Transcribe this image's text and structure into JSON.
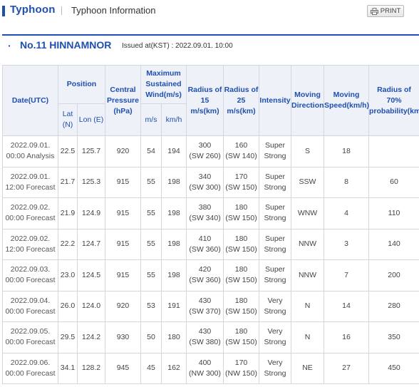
{
  "header": {
    "brand": "Typhoon",
    "subtitle": "Typhoon Information",
    "print_label": "PRINT"
  },
  "storm": {
    "name": "No.11 HINNAMNOR",
    "issued": "Issued at(KST) : 2022.09.01. 10:00"
  },
  "table": {
    "headers": {
      "date": "Date(UTC)",
      "position": "Position",
      "lat": "Lat (N)",
      "lon": "Lon (E)",
      "pressure": "Central Pressure (hPa)",
      "wind": "Maximum Sustained Wind(m/s)",
      "wind_ms": "m/s",
      "wind_kmh": "km/h",
      "r15": "Radius of 15 m/s(km)",
      "r25": "Radius of 25 m/s(km)",
      "intensity": "Intensity",
      "direction": "Moving Direction",
      "speed": "Moving Speed(km/h)",
      "r70": "Radius of 70% probability(km)"
    },
    "rows": [
      {
        "date1": "2022.09.01.",
        "date2": "00:00 Analysis",
        "lat": "22.5",
        "lon": "125.7",
        "pressure": "920",
        "ms": "54",
        "kmh": "194",
        "r15a": "300",
        "r15b": "(SW 260)",
        "r25a": "160",
        "r25b": "(SW 140)",
        "int1": "Super",
        "int2": "Strong",
        "dir": "S",
        "speed": "18",
        "r70": ""
      },
      {
        "date1": "2022.09.01.",
        "date2": "12:00 Forecast",
        "lat": "21.7",
        "lon": "125.3",
        "pressure": "915",
        "ms": "55",
        "kmh": "198",
        "r15a": "340",
        "r15b": "(SW 300)",
        "r25a": "170",
        "r25b": "(SW 150)",
        "int1": "Super",
        "int2": "Strong",
        "dir": "SSW",
        "speed": "8",
        "r70": "60"
      },
      {
        "date1": "2022.09.02.",
        "date2": "00:00 Forecast",
        "lat": "21.9",
        "lon": "124.9",
        "pressure": "915",
        "ms": "55",
        "kmh": "198",
        "r15a": "380",
        "r15b": "(SW 340)",
        "r25a": "180",
        "r25b": "(SW 150)",
        "int1": "Super",
        "int2": "Strong",
        "dir": "WNW",
        "speed": "4",
        "r70": "110"
      },
      {
        "date1": "2022.09.02.",
        "date2": "12:00 Forecast",
        "lat": "22.2",
        "lon": "124.7",
        "pressure": "915",
        "ms": "55",
        "kmh": "198",
        "r15a": "410",
        "r15b": "(SW 360)",
        "r25a": "180",
        "r25b": "(SW 150)",
        "int1": "Super",
        "int2": "Strong",
        "dir": "NNW",
        "speed": "3",
        "r70": "140"
      },
      {
        "date1": "2022.09.03.",
        "date2": "00:00 Forecast",
        "lat": "23.0",
        "lon": "124.5",
        "pressure": "915",
        "ms": "55",
        "kmh": "198",
        "r15a": "420",
        "r15b": "(SW 360)",
        "r25a": "180",
        "r25b": "(SW 150)",
        "int1": "Super",
        "int2": "Strong",
        "dir": "NNW",
        "speed": "7",
        "r70": "200"
      },
      {
        "date1": "2022.09.04.",
        "date2": "00:00 Forecast",
        "lat": "26.0",
        "lon": "124.0",
        "pressure": "920",
        "ms": "53",
        "kmh": "191",
        "r15a": "430",
        "r15b": "(SW 370)",
        "r25a": "180",
        "r25b": "(SW 150)",
        "int1": "Very",
        "int2": "Strong",
        "dir": "N",
        "speed": "14",
        "r70": "280"
      },
      {
        "date1": "2022.09.05.",
        "date2": "00:00 Forecast",
        "lat": "29.5",
        "lon": "124.2",
        "pressure": "930",
        "ms": "50",
        "kmh": "180",
        "r15a": "430",
        "r15b": "(SW 380)",
        "r25a": "180",
        "r25b": "(SW 150)",
        "int1": "Very",
        "int2": "Strong",
        "dir": "N",
        "speed": "16",
        "r70": "350"
      },
      {
        "date1": "2022.09.06.",
        "date2": "00:00 Forecast",
        "lat": "34.1",
        "lon": "128.2",
        "pressure": "945",
        "ms": "45",
        "kmh": "162",
        "r15a": "400",
        "r15b": "(NW 300)",
        "r25a": "170",
        "r25b": "(NW 150)",
        "int1": "Very",
        "int2": "Strong",
        "dir": "NE",
        "speed": "27",
        "r70": "450"
      }
    ]
  },
  "colors": {
    "accent": "#1f4fb0",
    "header_bg": "#eef1f8",
    "border": "#d4d8de"
  }
}
